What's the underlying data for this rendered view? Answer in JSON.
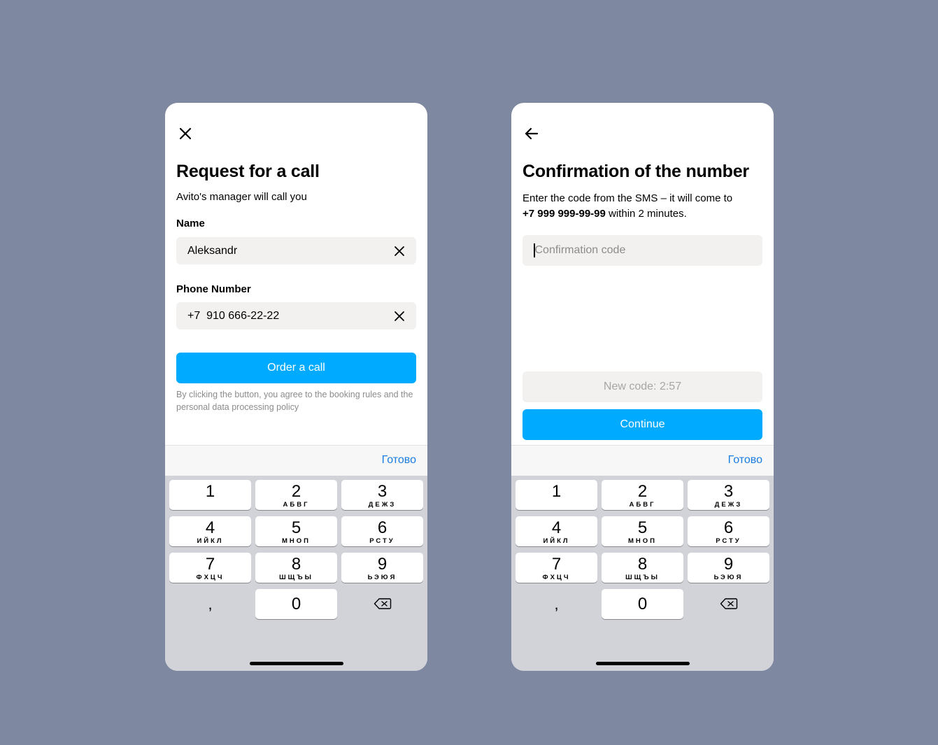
{
  "screen1": {
    "close_icon": "close-icon",
    "title": "Request for a call",
    "subtitle": "Avito's manager will call you",
    "name_label": "Name",
    "name_value": "Aleksandr",
    "phone_label": "Phone Number",
    "phone_value": "+7  910 666-22-22",
    "order_button": "Order a call",
    "legal_text": "By clicking the button, you agree to the booking rules and the personal data processing policy",
    "toolbar_done": "Готово"
  },
  "screen2": {
    "back_icon": "arrow-left-icon",
    "title": "Confirmation of the number",
    "desc_prefix": "Enter the code from the SMS – it will come to",
    "desc_phone": "+7 999 999-99-99",
    "desc_suffix": "within 2 minutes.",
    "code_placeholder": "Confirmation code",
    "new_code_button": "New code: 2:57",
    "continue_button": "Continue",
    "toolbar_done": "Готово"
  },
  "keypad": {
    "keys": [
      {
        "num": "1",
        "letters": ""
      },
      {
        "num": "2",
        "letters": "АБВГ"
      },
      {
        "num": "3",
        "letters": "ДЕЖЗ"
      },
      {
        "num": "4",
        "letters": "ИЙКЛ"
      },
      {
        "num": "5",
        "letters": "МНОП"
      },
      {
        "num": "6",
        "letters": "РСТУ"
      },
      {
        "num": "7",
        "letters": "ФХЦЧ"
      },
      {
        "num": "8",
        "letters": "ШЩЪЫ"
      },
      {
        "num": "9",
        "letters": "ЬЭЮЯ"
      }
    ],
    "comma": ",",
    "zero": "0",
    "delete_icon": "backspace-icon"
  },
  "colors": {
    "background": "#7f88a1",
    "accent": "#00aaff",
    "done_link": "#1a7de0",
    "field_bg": "#f2f1f0"
  }
}
